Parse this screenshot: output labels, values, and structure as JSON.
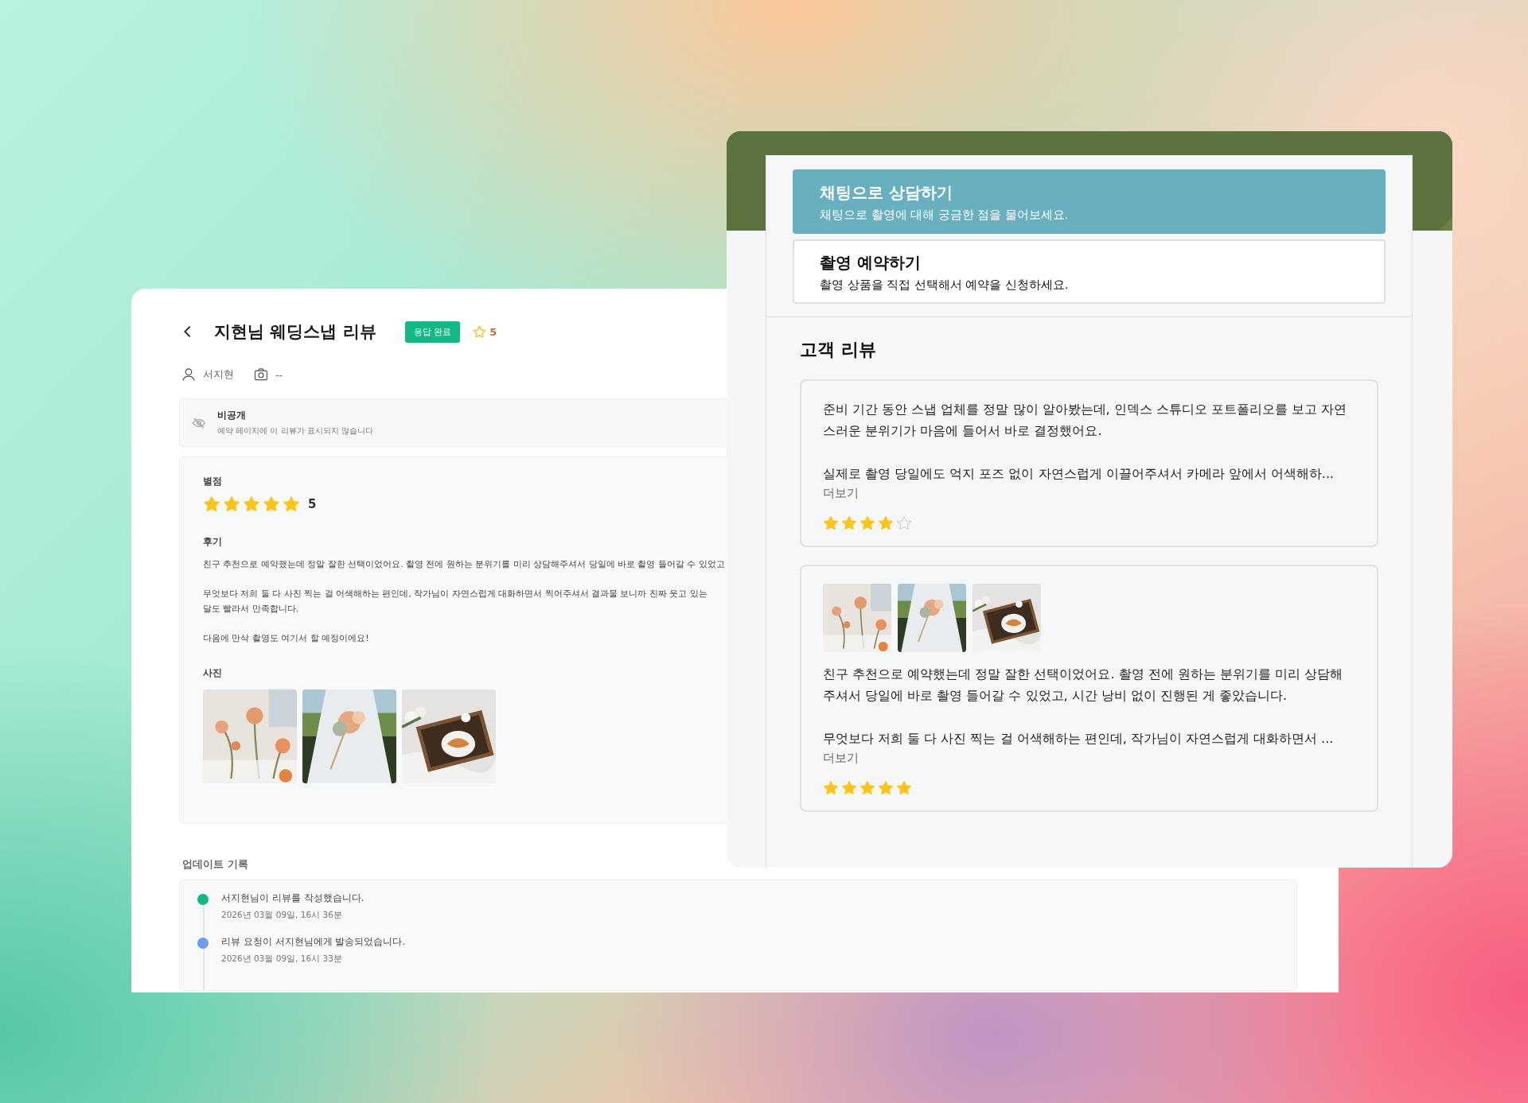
{
  "review_detail": {
    "title": "지현님 웨딩스냅 리뷰",
    "status": "응답 완료",
    "rating_badge": "5",
    "author": "서지현",
    "camera": "--",
    "visibility": {
      "label": "비공개",
      "description": "예약 페이지에 이 리뷰가 표시되지 않습니다"
    },
    "rating": {
      "label": "별점",
      "stars": 5,
      "value": "5"
    },
    "review": {
      "label": "후기",
      "paragraphs": [
        [
          "친구 추천으로 예약했는데 정말 잘한 선택이었어요. 촬영 전에 원하는 분위기를 미리 상담해주셔서 당일에 바로 촬영 들어갈 수 있었고"
        ],
        [
          "무엇보다 저희 둘 다 사진 찍는 걸 어색해하는 편인데, 작가님이 자연스럽게 대화하면서 찍어주셔서 결과물 보니까 진짜 웃고 있는",
          "달도 빨라서 만족합니다."
        ],
        [
          "다음에 만삭 촬영도 여기서 할 예정이에요!"
        ]
      ]
    },
    "photos": {
      "label": "사진",
      "items": [
        {
          "kind": "picture"
        },
        {
          "kind": "picture"
        },
        {
          "kind": "picture"
        }
      ]
    },
    "update_log": {
      "title": "업데이트 기록",
      "entries": [
        {
          "text": "서지현님이 리뷰를 작성했습니다.",
          "time": "2026년 03월 09일, 16시 36분",
          "color": "#12b886"
        },
        {
          "text": "리뷰 요청이 서지현님에게 발송되었습니다.",
          "time": "2026년 03월 09일, 16시 33분",
          "color": "#6b9cf0"
        }
      ]
    }
  },
  "booking_page": {
    "cover": {
      "kind": "picture"
    },
    "actions": [
      {
        "title": "채팅으로 상담하기",
        "description": "채팅으로 촬영에 대해 궁금한 점을 물어보세요.",
        "selected": true
      },
      {
        "title": "촬영 예약하기",
        "description": "촬영 상품을 직접 선택해서 예약을 신청하세요.",
        "selected": false
      }
    ],
    "reviews_title": "고객 리뷰",
    "reviews": [
      {
        "paragraphs": [
          "준비 기간 동안 스냅 업체를 정말 많이 알아봤는데, 인덱스 스튜디오 포트폴리오를 보고 자연스러운 분위기가 마음에 들어서 바로 결정했어요.",
          "실제로 촬영 당일에도 억지 포즈 없이 자연스럽게 이끌어주셔서 카메라 앞에서 어색해하..."
        ],
        "more": "더보기",
        "stars": 4
      },
      {
        "photos": [
          {
            "kind": "picture"
          },
          {
            "kind": "picture"
          },
          {
            "kind": "picture"
          }
        ],
        "paragraphs": [
          "친구 추천으로 예약했는데 정말 잘한 선택이었어요. 촬영 전에 원하는 분위기를 미리 상담해주셔서 당일에 바로 촬영 들어갈 수 있었고, 시간 낭비 없이 진행된 게 좋았습니다.",
          "무엇보다 저희 둘 다 사진 찍는 걸 어색해하는 편인데, 작가님이 자연스럽게 대화하면서 ..."
        ],
        "more": "더보기",
        "stars": 5
      }
    ]
  }
}
